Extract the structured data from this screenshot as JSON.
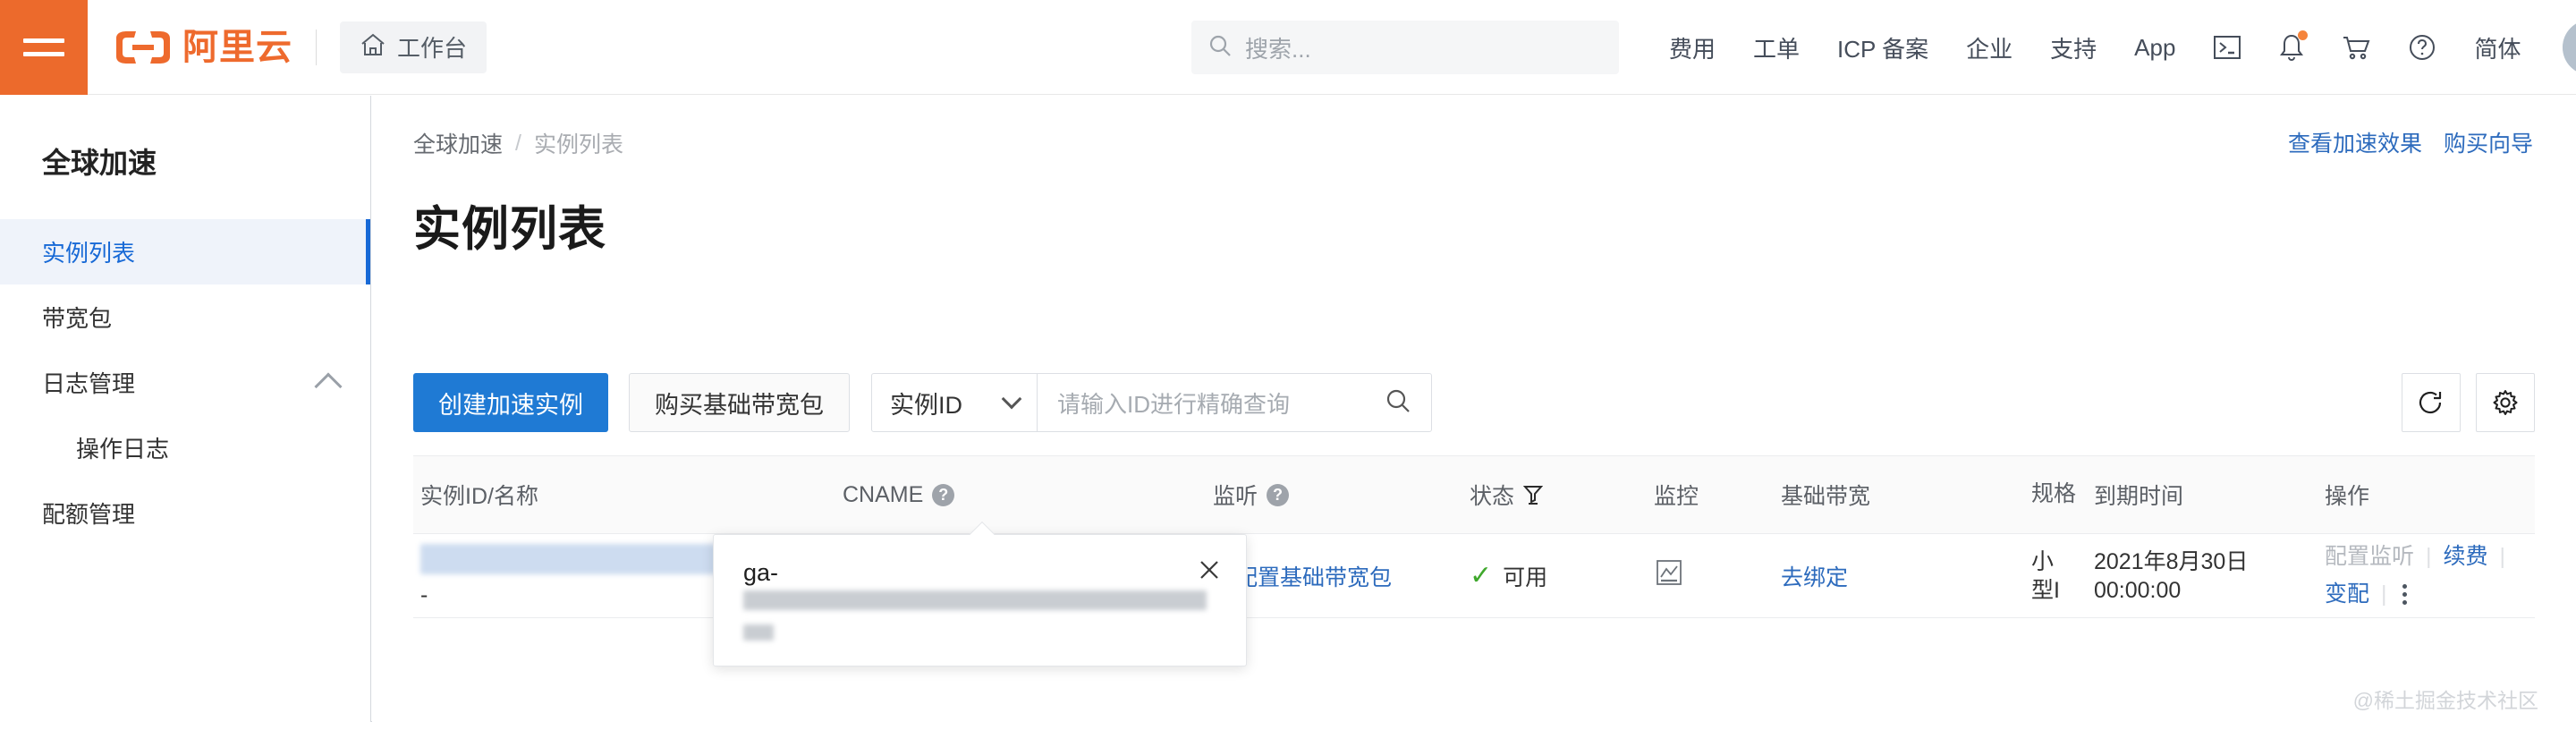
{
  "header": {
    "menu_icon": "hamburger-icon",
    "logo_text": "阿里云",
    "workbench_label": "工作台",
    "workbench_icon": "home-icon",
    "search_placeholder": "搜索...",
    "search_icon": "search-icon",
    "nav_items": [
      {
        "label": "费用"
      },
      {
        "label": "工单"
      },
      {
        "label": "ICP 备案"
      },
      {
        "label": "企业"
      },
      {
        "label": "支持"
      },
      {
        "label": "App"
      }
    ],
    "icons": [
      {
        "name": "terminal-icon"
      },
      {
        "name": "bell-icon",
        "has_dot": true
      },
      {
        "name": "cart-icon"
      },
      {
        "name": "help-icon"
      }
    ],
    "lang_label": "简体",
    "avatar_name": "user-avatar"
  },
  "sidebar": {
    "title": "全球加速",
    "items": [
      {
        "label": "实例列表",
        "active": true,
        "sub": false,
        "expandable": false
      },
      {
        "label": "带宽包",
        "active": false,
        "sub": false,
        "expandable": false
      },
      {
        "label": "日志管理",
        "active": false,
        "sub": false,
        "expandable": true
      },
      {
        "label": "操作日志",
        "active": false,
        "sub": true,
        "expandable": false
      },
      {
        "label": "配额管理",
        "active": false,
        "sub": false,
        "expandable": false
      }
    ]
  },
  "main": {
    "breadcrumb": {
      "root": "全球加速",
      "separator": "/",
      "current": "实例列表"
    },
    "header_links": [
      {
        "label": "查看加速效果"
      },
      {
        "label": "购买向导"
      }
    ],
    "page_title": "实例列表",
    "toolbar": {
      "create_label": "创建加速实例",
      "buy_bandwidth_label": "购买基础带宽包",
      "filter_select_value": "实例ID",
      "search_placeholder": "请输入ID进行精确查询",
      "search_icon": "search-icon",
      "refresh_icon": "refresh-icon",
      "settings_icon": "gear-icon"
    },
    "table": {
      "columns": [
        {
          "label": "实例ID/名称",
          "help": false,
          "filter": false
        },
        {
          "label": "CNAME",
          "help": true,
          "filter": false
        },
        {
          "label": "监听",
          "help": true,
          "filter": false
        },
        {
          "label": "状态",
          "help": false,
          "filter": true
        },
        {
          "label": "监控",
          "help": false,
          "filter": false
        },
        {
          "label": "基础带宽",
          "help": false,
          "filter": false
        },
        {
          "label": "规格",
          "help": false,
          "filter": false
        },
        {
          "label": "到期时间",
          "help": false,
          "filter": false
        },
        {
          "label": "操作",
          "help": false,
          "filter": false
        }
      ],
      "rows": [
        {
          "instance_id": "",
          "instance_name": "-",
          "cname_prefix": "g",
          "copy_icon": "copy-icon",
          "listener_link": "先配置基础带宽包",
          "status_icon": "check-icon",
          "status": "可用",
          "monitor_icon": "chart-icon",
          "bandwidth_link": "去绑定",
          "spec_line1": "小",
          "spec_line2": "型I",
          "expire_line1": "2021年8月30日",
          "expire_line2": "00:00:00",
          "ops": [
            {
              "label": "配置监听",
              "disabled": true
            },
            {
              "label": "续费",
              "disabled": false
            },
            {
              "label": "变配",
              "disabled": false
            }
          ],
          "more_icon": "more-vertical-icon"
        }
      ]
    },
    "popover": {
      "title": "ga-",
      "close_icon": "close-icon"
    }
  },
  "watermark": "@稀土掘金技术社区",
  "colors": {
    "brand_orange": "#ec6a2c",
    "primary_blue": "#1f7ad4",
    "link_blue": "#2d6bbd",
    "status_green": "#3fa82c",
    "active_bg": "#eff3fa"
  }
}
